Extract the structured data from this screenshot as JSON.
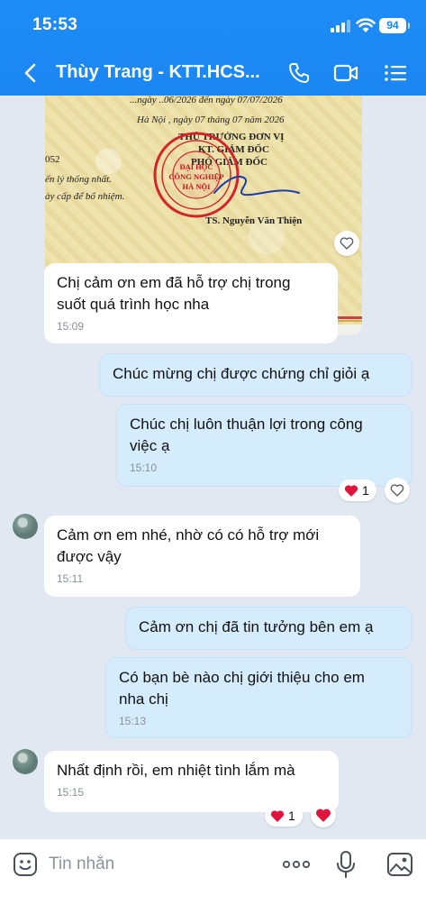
{
  "status_bar": {
    "time": "15:53",
    "battery": "94"
  },
  "header": {
    "title": "Thùy Trang - KTT.HCS...",
    "icons": [
      "back-icon",
      "phone-icon",
      "video-icon",
      "menu-icon"
    ]
  },
  "certificate": {
    "lines": [
      "...ngày ..06/2026  đến ngày  07/07/2026",
      "Hà Nội , ngày  07  tháng  07  năm  2026",
      "THỦ TRƯỞNG ĐƠN VỊ",
      "KT. GIÁM ĐỐC",
      "PHÓ GIÁM ĐỐC",
      "052",
      "ến lý thống nhất.",
      "ày cấp để bổ nhiệm.",
      "TS. Nguyễn Văn Thiện"
    ],
    "stamp_text": [
      "ĐẠI HỌC",
      "CÔNG NGHIỆP",
      "HÀ NỘI"
    ]
  },
  "messages": [
    {
      "side": "in",
      "text": "Chị cảm ơn em đã hỗ trợ chị trong\nsuốt quá trình học nha",
      "time": "15:09"
    },
    {
      "side": "out",
      "text": "Chúc mừng chị được chứng chỉ giỏi ạ",
      "time": ""
    },
    {
      "side": "out",
      "text": "Chúc chị luôn thuận lợi trong công\nviệc ạ",
      "time": "15:10",
      "reaction_count": "1"
    },
    {
      "side": "in",
      "text": "Cảm ơn em nhé, nhờ có có hỗ trợ mới\nđược vậy",
      "time": "15:11"
    },
    {
      "side": "out",
      "text": "Cảm ơn chị đã tin tưởng bên em ạ",
      "time": ""
    },
    {
      "side": "out",
      "text": "Có bạn bè nào chị giới thiệu cho em\nnha chị",
      "time": "15:13"
    },
    {
      "side": "in",
      "text": "Nhất định rồi, em nhiệt tình lắm mà",
      "time": "15:15",
      "reaction_count": "1"
    }
  ],
  "input_bar": {
    "placeholder": "Tin nhắn"
  },
  "colors": {
    "header": "#1a86f2",
    "out_bubble": "#d5ecfd",
    "in_bubble": "#ffffff",
    "background": "#e2e8f1",
    "heart": "#e0143c"
  }
}
